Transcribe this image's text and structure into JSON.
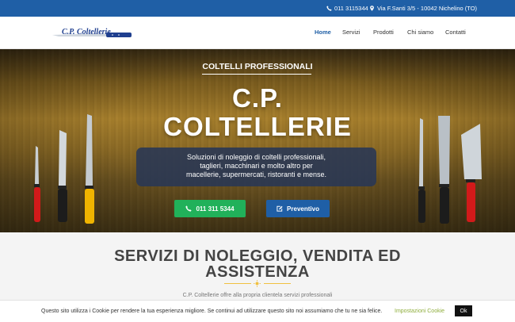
{
  "topbar": {
    "phone": "011 3115344",
    "address": "Via F.Santi 3/5 - 10042 Nichelino (TO)"
  },
  "header": {
    "logo_text": "C.P. Coltellerie",
    "nav": [
      "Home",
      "Servizi",
      "Prodotti",
      "Chi siamo",
      "Contatti"
    ],
    "active_nav": "Home",
    "accent": "#1f5fa6"
  },
  "hero": {
    "kicker": "COLTELLI PROFESSIONALI",
    "title_line1": "C.P.",
    "title_line2": "COLTELLERIE",
    "description": [
      "Soluzioni di noleggio di coltelli professionali,",
      "taglieri, macchinari e molto altro per",
      "macellerie, supermercati, ristoranti e mense."
    ],
    "phone_button": "011 311 5344",
    "quote_button": "Preventivo",
    "phone_button_color": "#21b15a"
  },
  "services": {
    "title_line1": "SERVIZI DI NOLEGGIO, VENDITA ED",
    "title_line2": "ASSISTENZA",
    "intro": "C.P. Coltellerie offre alla propria clientela servizi professionali"
  },
  "cookie": {
    "message": "Questo sito utilizza i Cookie per rendere la tua esperienza migliore. Se continui ad utilizzare questo sito noi assumiamo che tu ne sia felice.",
    "settings_label": "Impostazioni Cookie",
    "ok_label": "Ok"
  },
  "icons": [
    "phone-icon",
    "map-pin-icon",
    "edit-icon",
    "sun-icon"
  ]
}
